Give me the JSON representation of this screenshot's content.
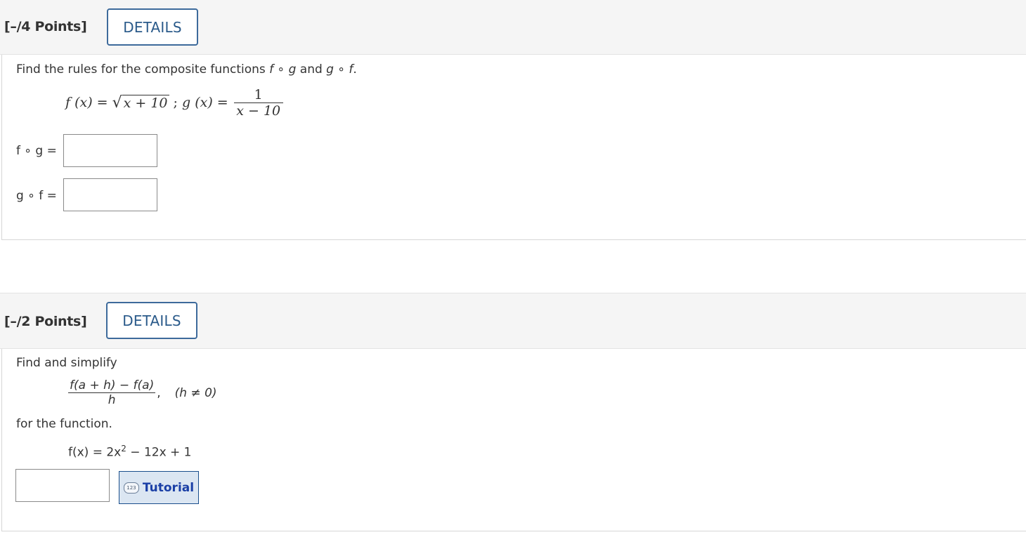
{
  "question1": {
    "points": "[–/4 Points]",
    "details_label": "DETAILS",
    "prompt_pre": "Find the rules for the composite functions ",
    "prompt_fog": "f ∘ g",
    "prompt_and": " and ",
    "prompt_gof": "g ∘ f",
    "prompt_end": ".",
    "eq_f_lhs": "f (x) =",
    "eq_f_radicand": "x + 10",
    "eq_sep": " ; ",
    "eq_g_lhs": "g (x) =",
    "eq_g_num": "1",
    "eq_g_den": "x − 10",
    "fog_label": "f ∘ g =",
    "gof_label": "g ∘ f =",
    "fog_value": "",
    "gof_value": ""
  },
  "question2": {
    "points": "[–/2 Points]",
    "details_label": "DETAILS",
    "prompt": "Find and simplify",
    "frac_num": "f(a + h) − f(a)",
    "frac_den": "h",
    "frac_comma": ",",
    "condition": "(h ≠ 0)",
    "for_function": "for the function.",
    "function_lhs": "f(x) = 2x",
    "function_exp": "2",
    "function_rhs": " − 12x + 1",
    "answer_value": "",
    "tutorial_label": "Tutorial",
    "tutorial_icon_text": "123"
  }
}
